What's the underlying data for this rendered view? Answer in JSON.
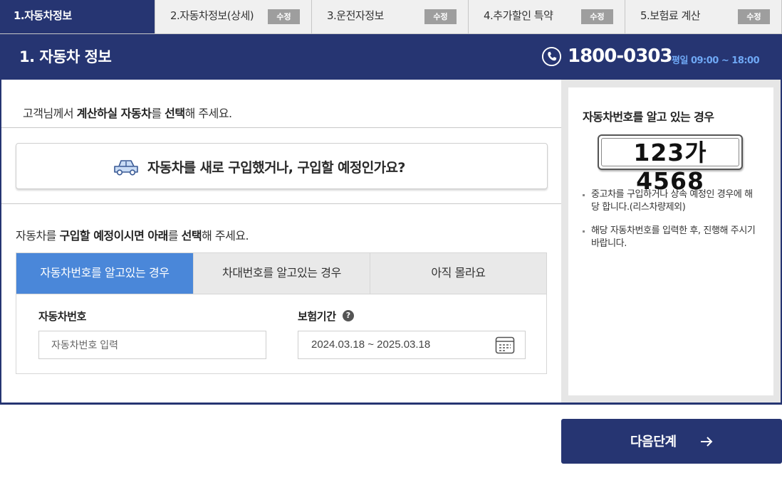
{
  "steps": [
    {
      "label": "1.자동차정보",
      "active": true,
      "badge": ""
    },
    {
      "label": "2.자동차정보(상세)",
      "active": false,
      "badge": "수정"
    },
    {
      "label": "3.운전자정보",
      "active": false,
      "badge": "수정"
    },
    {
      "label": "4.추가할인 특약",
      "active": false,
      "badge": "수정"
    },
    {
      "label": "5.보험료 계산",
      "active": false,
      "badge": "수정"
    }
  ],
  "header": {
    "title": "1. 자동차 정보",
    "phone": "1800-0303",
    "hours": "평일 09:00 ~ 18:00"
  },
  "intro": {
    "pre": "고객님께서 ",
    "bold1": "계산하실 자동차",
    "mid": "를 ",
    "bold2": "선택",
    "post": "해 주세요."
  },
  "new_car_button": "자동차를 새로 구입했거나, 구입할 예정인가요?",
  "purchase": {
    "pre": "자동차를 ",
    "bold1": "구입할 예정이시면 아래",
    "mid": "를 ",
    "bold2": "선택",
    "post": "해 주세요."
  },
  "options": [
    "자동차번호를 알고있는 경우",
    "차대번호를 알고있는 경우",
    "아직 몰라요"
  ],
  "form": {
    "car_number_label": "자동차번호",
    "car_number_placeholder": "자동차번호 입력",
    "car_number_value": "",
    "period_label": "보험기간",
    "help": "?",
    "period_value": "2024.03.18 ~ 2025.03.18"
  },
  "info": {
    "title": "자동차번호를 알고 있는 경우",
    "plate": "123가 4568",
    "notes": [
      "중고차를 구입하거나 상속 예정인 경우에 해당 합니다.(리스차량제외)",
      "해당 자동차번호를 입력한 후, 진행해 주시기 바랍니다."
    ]
  },
  "next_button": "다음단계",
  "colors": {
    "navy": "#263572",
    "active_option": "#4a87d9",
    "hours": "#6fa8f5",
    "badge": "#9e9e9e"
  },
  "icons": [
    "phone-icon",
    "car-icon",
    "help-icon",
    "calendar-icon",
    "arrow-right-icon"
  ]
}
